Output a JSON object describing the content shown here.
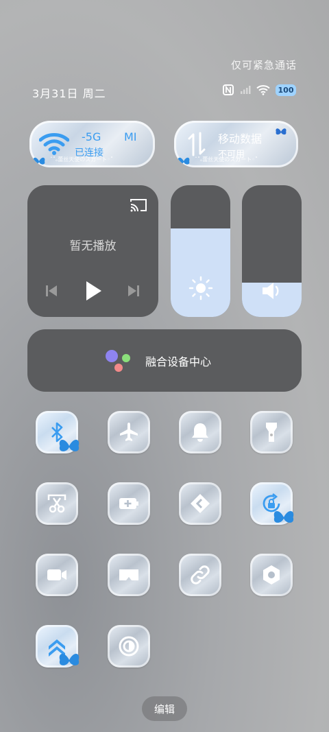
{
  "header": {
    "emergency_text": "仅可紧急通话",
    "date": "3月31日 周二",
    "battery": "100"
  },
  "wifi_tile": {
    "network": "-5G",
    "status": "已连接",
    "tag": "MI",
    "caption": "ˆ˚ₒ蕾丝天使のスカート◦˚"
  },
  "data_tile": {
    "title": "移动数据",
    "status": "不可用",
    "caption": "ˆ˚ₒ蕾丝天使のスカート◦˚"
  },
  "media": {
    "status": "暂无播放"
  },
  "sliders": {
    "brightness_level": 0.67,
    "volume_level": 0.26
  },
  "device_center": {
    "label": "融合设备中心"
  },
  "toggles": [
    {
      "name": "bluetooth",
      "on": true
    },
    {
      "name": "airplane",
      "on": false
    },
    {
      "name": "bell",
      "on": false
    },
    {
      "name": "flashlight",
      "on": false
    },
    {
      "name": "screenshot",
      "on": false
    },
    {
      "name": "battery-saver",
      "on": false
    },
    {
      "name": "cast",
      "on": false
    },
    {
      "name": "rotation-lock",
      "on": true
    },
    {
      "name": "screen-record",
      "on": false
    },
    {
      "name": "vr",
      "on": false
    },
    {
      "name": "link",
      "on": false
    },
    {
      "name": "settings",
      "on": false
    },
    {
      "name": "performance",
      "on": true
    },
    {
      "name": "focus",
      "on": false
    }
  ],
  "footer": {
    "edit_label": "编辑"
  },
  "colors": {
    "accent": "#3a9cf0",
    "slider_fill": "#cfe0f7",
    "dark_panel": "#5a5b5d"
  }
}
